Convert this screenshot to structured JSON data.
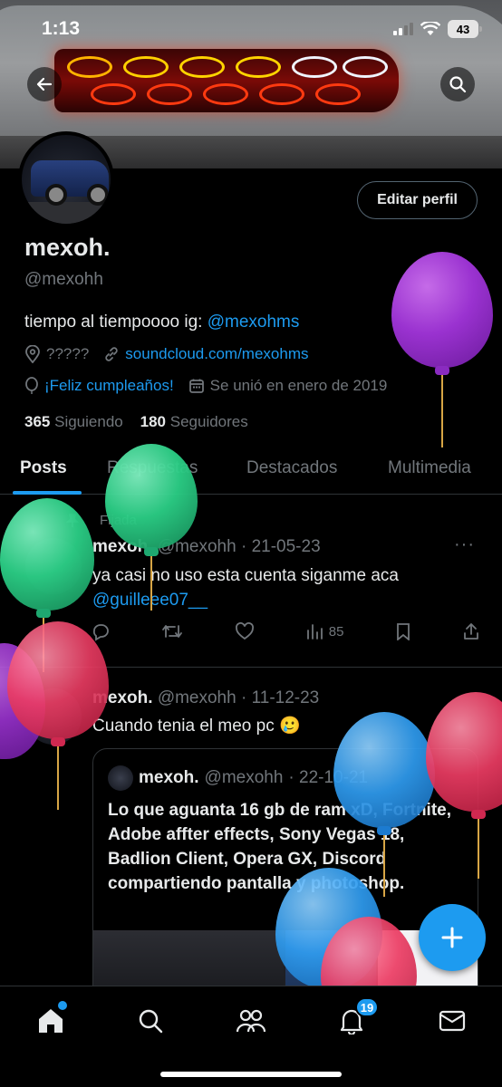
{
  "status": {
    "time": "1:13",
    "battery": "43"
  },
  "profile": {
    "name": "mexoh.",
    "handle": "@mexohh",
    "edit_label": "Editar perfil",
    "bio_text": "tiempo al tiempoooo ig: ",
    "bio_link": "@mexohms",
    "location": "?????",
    "website": "soundcloud.com/mexohms",
    "birthday": "¡Feliz cumpleaños!",
    "joined": "Se unió en enero de 2019",
    "following_count": "365",
    "following_label": "Siguiendo",
    "followers_count": "180",
    "followers_label": "Seguidores"
  },
  "tabs": [
    "Posts",
    "Respuestas",
    "Destacados",
    "Multimedia"
  ],
  "posts": [
    {
      "pinned_label": "Fijada",
      "name": "mexoh.",
      "handle": "@mexohh",
      "date": "· 21-05-23",
      "text": "ya casi no uso esta cuenta siganme aca",
      "mention": "@guilleee07__",
      "views": "85"
    },
    {
      "name": "mexoh.",
      "handle": "@mexohh",
      "date": "· 11-12-23",
      "text": "Cuando tenia el meo pc 🥲",
      "quote": {
        "name": "mexoh.",
        "handle": "@mexohh",
        "date": "· 22-10-21",
        "text": "Lo que aguanta 16 gb de ram xD, Fortnite, Adobe affter effects, Sony Vegas 18, Badlion Client, Opera GX, Discord compartiendo pantalla y photoshop."
      }
    }
  ],
  "nav": {
    "notifications_badge": "19"
  },
  "icons": [
    "back-arrow-icon",
    "search-icon",
    "location-icon",
    "link-icon",
    "balloon-icon",
    "calendar-icon",
    "pin-icon",
    "reply-icon",
    "retweet-icon",
    "like-icon",
    "views-icon",
    "bookmark-icon",
    "share-icon",
    "plus-icon",
    "home-icon",
    "people-icon",
    "bell-icon",
    "mail-icon"
  ],
  "colors": {
    "accent": "#1d9bf0",
    "background": "#000000",
    "muted": "#71767b"
  }
}
